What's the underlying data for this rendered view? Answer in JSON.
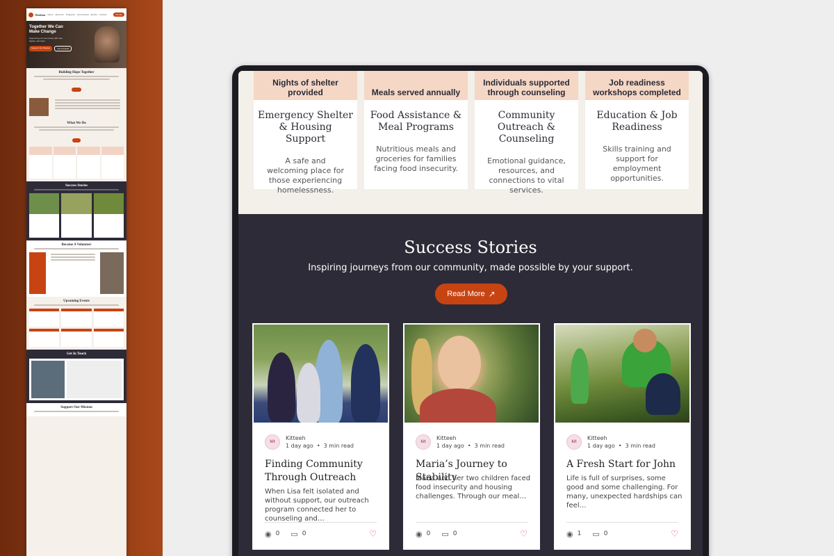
{
  "thumbnail": {
    "brand": "Brisfane",
    "nav_links": [
      "Home",
      "About Us",
      "Programs",
      "Get Involved",
      "Events",
      "Contact"
    ],
    "donate_label": "Donate",
    "hero_title": "Together We Can Make Change",
    "hero_sub": "Supporting our community with care, dignity, and hope.",
    "hero_btn_primary": "Support Our Mission",
    "hero_btn_secondary": "Get Involved",
    "section_building": "Building Hope Together",
    "section_what": "What We Do",
    "section_stories": "Success Stories",
    "section_volunteer": "Become A Volunteer",
    "section_events": "Upcoming Events",
    "section_contact": "Get In Touch",
    "section_mission": "Support Our Mission"
  },
  "programs": [
    {
      "stat": "Nights of shelter provided",
      "title": "Emergency Shelter & Housing Support",
      "desc": "A safe and welcoming place for those experiencing homelessness."
    },
    {
      "stat": "Meals served annually",
      "title": "Food Assistance & Meal Programs",
      "desc": "Nutritious meals and groceries for families facing food insecurity."
    },
    {
      "stat": "Individuals supported through counseling",
      "title": "Community Outreach & Counseling",
      "desc": "Emotional guidance, resources, and connections to vital services."
    },
    {
      "stat": "Job readiness workshops completed",
      "title": "Education & Job Readiness",
      "desc": "Skills training and support for employment opportunities."
    }
  ],
  "stories": {
    "title": "Success Stories",
    "subtitle": "Inspiring journeys from our community, made possible by your support.",
    "read_more": "Read More",
    "cards": [
      {
        "author": "Kitteeh",
        "time": "1 day ago",
        "read": "3 min read",
        "title": "Finding Community Through Outreach",
        "excerpt": "When Lisa felt isolated and without support, our outreach program connected her to counseling and…",
        "views": "0",
        "comments": "0"
      },
      {
        "author": "Kitteeh",
        "time": "1 day ago",
        "read": "3 min read",
        "title": "Maria’s Journey to Stability",
        "excerpt": "Maria and her two children faced food insecurity and housing challenges. Through our meal…",
        "views": "0",
        "comments": "0"
      },
      {
        "author": "Kitteeh",
        "time": "1 day ago",
        "read": "3 min read",
        "title": "A Fresh Start for John",
        "excerpt": "Life is full of surprises, some good and some challenging. For many, unexpected hardships can feel…",
        "views": "1",
        "comments": "0"
      }
    ]
  },
  "colors": {
    "accent": "#c74412",
    "dark_section": "#2e2b38",
    "stat_bg": "#f5d7c6",
    "page_bg": "#f3efe9"
  }
}
